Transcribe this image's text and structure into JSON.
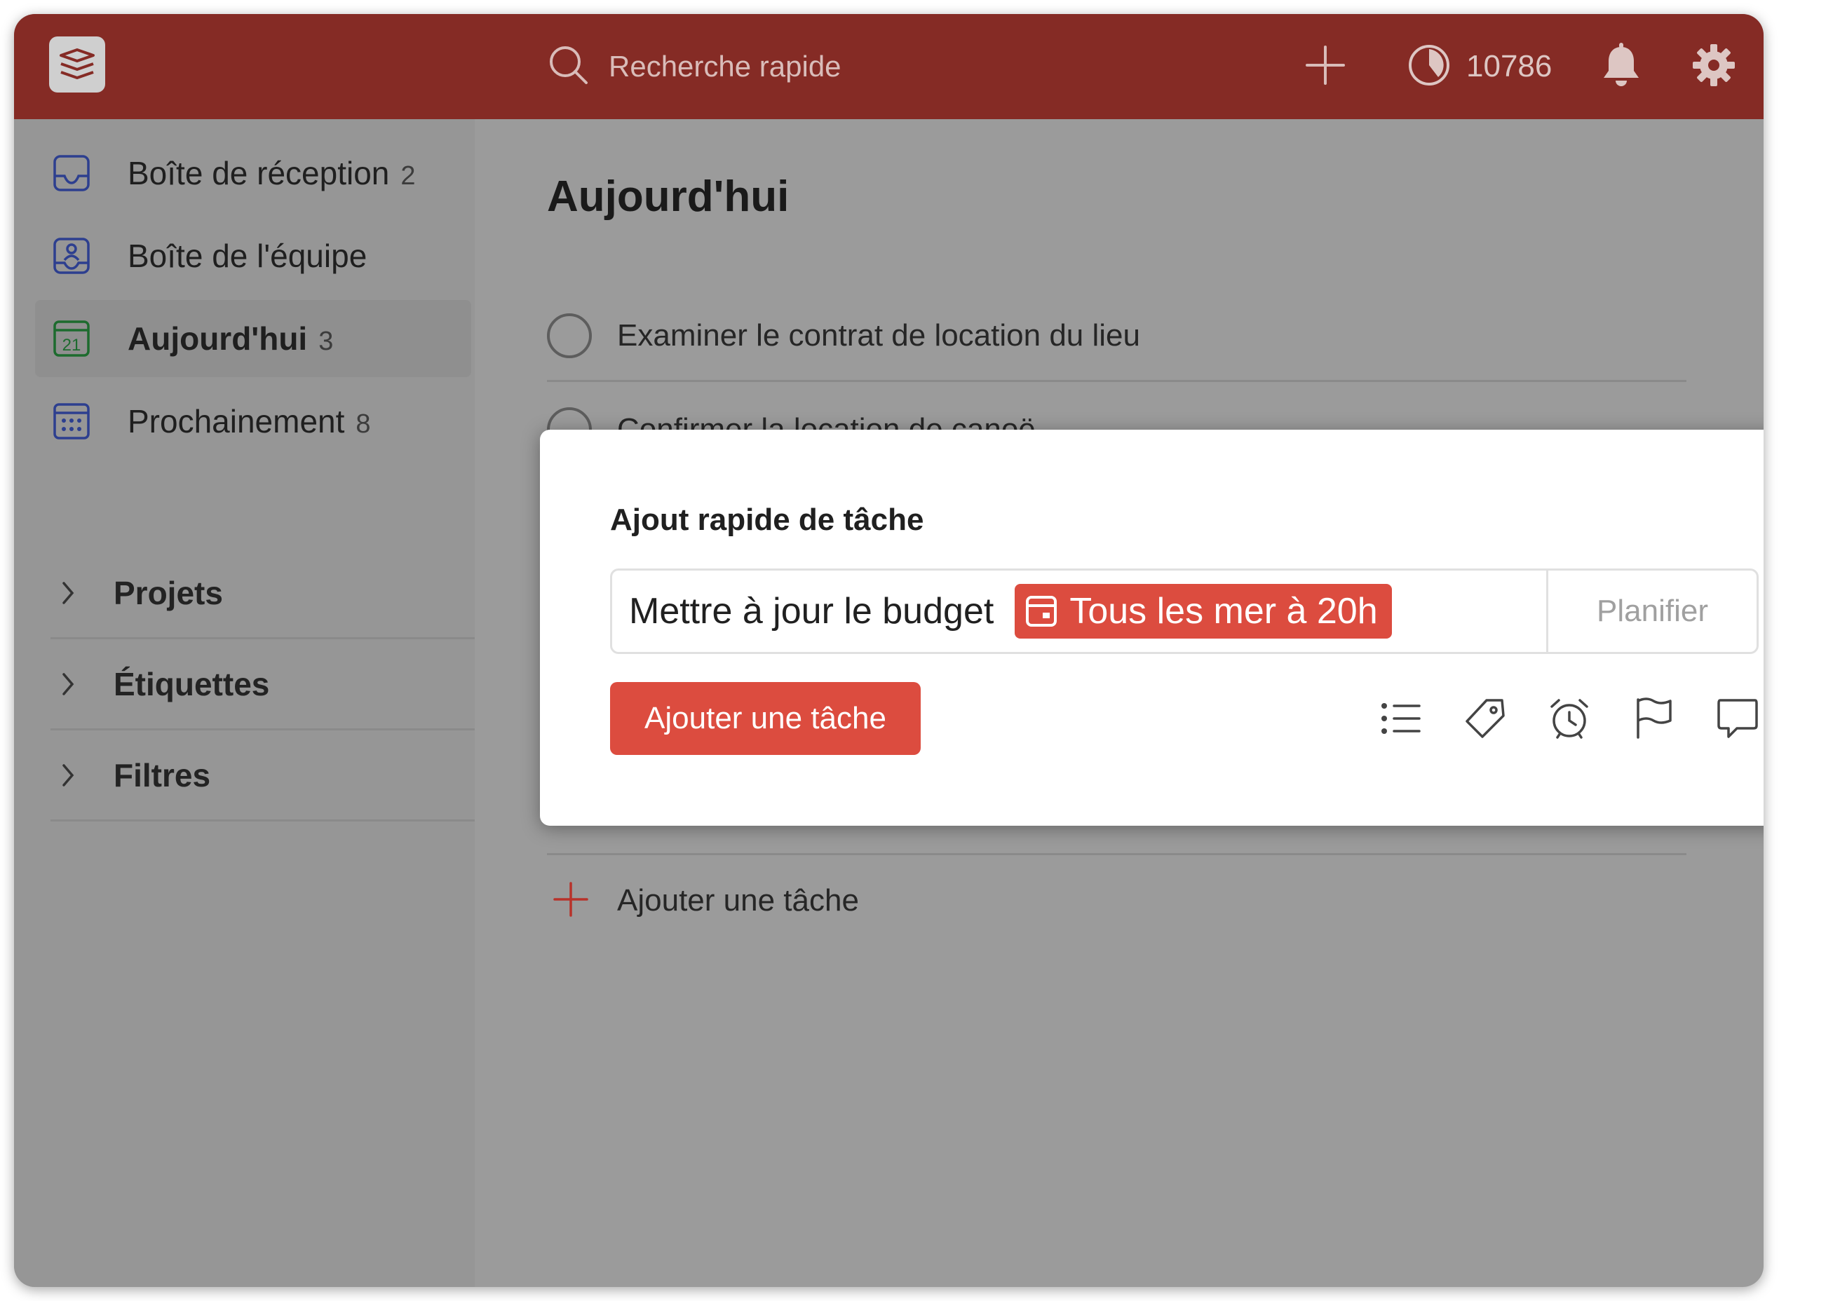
{
  "header": {
    "search_placeholder": "Recherche rapide",
    "karma_count": "10786",
    "icons": [
      "logo-icon",
      "search-icon",
      "plus-icon",
      "karma-icon",
      "bell-icon",
      "gear-icon"
    ]
  },
  "sidebar": {
    "items": [
      {
        "label": "Boîte de réception",
        "count": "2",
        "icon": "inbox-icon"
      },
      {
        "label": "Boîte de l'équipe",
        "count": "",
        "icon": "team-inbox-icon"
      },
      {
        "label": "Aujourd'hui",
        "count": "3",
        "icon": "calendar-today-icon",
        "active": true
      },
      {
        "label": "Prochainement",
        "count": "8",
        "icon": "calendar-upcoming-icon"
      }
    ],
    "sections": [
      {
        "label": "Projets"
      },
      {
        "label": "Étiquettes"
      },
      {
        "label": "Filtres"
      }
    ],
    "today_day_number": "21"
  },
  "main": {
    "title": "Aujourd'hui",
    "tasks": [
      {
        "label": "Examiner le contrat de location du lieu"
      },
      {
        "label": "Confirmer la location de canoë"
      }
    ],
    "add_task_label": "Ajouter une tâche"
  },
  "quick_add": {
    "title": "Ajout rapide de tâche",
    "input_value": "Mettre à jour le budget",
    "date_chip": "Tous les mer à 20h",
    "schedule_label": "Planifier",
    "submit_label": "Ajouter une tâche",
    "tools": [
      "list-icon",
      "tag-icon",
      "alarm-icon",
      "flag-icon",
      "comment-icon"
    ]
  },
  "colors": {
    "header_bg": "#852b25",
    "accent": "#dc4c3f",
    "overlay_gray": "#9b9b9b",
    "icon_blue": "#2d3f8f",
    "icon_green": "#1d6b2e"
  }
}
